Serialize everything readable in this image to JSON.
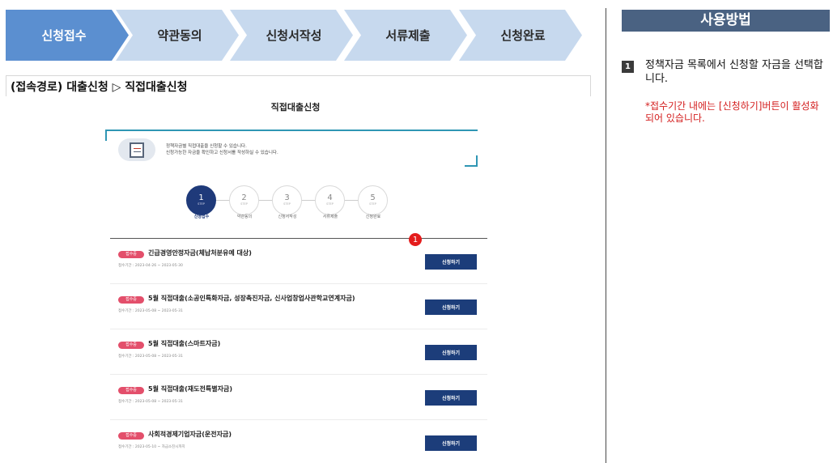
{
  "top_steps": [
    {
      "label": "신청접수",
      "active": true
    },
    {
      "label": "약관동의",
      "active": false
    },
    {
      "label": "신청서작성",
      "active": false
    },
    {
      "label": "서류제출",
      "active": false
    },
    {
      "label": "신청완료",
      "active": false
    }
  ],
  "access_path": "(접속경로) 대출신청 ▷ 직접대출신청",
  "inner": {
    "title": "직접대출신청",
    "info_line1": "정책자금별 직접대출을 신청할 수 있습니다.",
    "info_line2": "신청가능한 자금을 확인하고 신청서를 작성하실 수 있습니다.",
    "steps": [
      {
        "num": "1",
        "step": "STEP",
        "label": "신청접수"
      },
      {
        "num": "2",
        "step": "STEP",
        "label": "약관동의"
      },
      {
        "num": "3",
        "step": "STEP",
        "label": "신청서작성"
      },
      {
        "num": "4",
        "step": "STEP",
        "label": "서류제출"
      },
      {
        "num": "5",
        "step": "STEP",
        "label": "신청완료"
      }
    ],
    "marker": "1",
    "items": [
      {
        "badge": "접수중",
        "title": "긴급경영안정자금(체납처분유예 대상)",
        "period": "접수기간 : 2023-04-26 ~ 2023-05-30",
        "button": "신청하기"
      },
      {
        "badge": "접수중",
        "title": "5월 직접대출(소공인특화자금, 성장촉진자금, 신사업창업사관학교연계자금)",
        "period": "접수기간 : 2023-05-08 ~ 2023-05-31",
        "button": "신청하기"
      },
      {
        "badge": "접수중",
        "title": "5월 직접대출(스마트자금)",
        "period": "접수기간 : 2023-05-08 ~ 2023-05-31",
        "button": "신청하기"
      },
      {
        "badge": "접수중",
        "title": "5월 직접대출(재도전특별자금)",
        "period": "접수기간 : 2023-05-08 ~ 2023-05-31",
        "button": "신청하기"
      },
      {
        "badge": "접수중",
        "title": "사회적경제기업자금(운전자금)",
        "period": "접수기간 : 2023-05-10 ~ 자금소진시까지",
        "button": "신청하기"
      }
    ]
  },
  "panel": {
    "header": "사용방법",
    "step_num": "1",
    "instruction": "정책자금 목록에서 신청할 자금을 선택합니다.",
    "note": "*접수기간 내에는 [신청하기]버튼이 활성화 되어 있습니다."
  },
  "colors": {
    "active_step": "#5b8fd0",
    "inactive_step": "#c7d9ee",
    "panel_header": "#4a6282",
    "apply_button": "#1c3d7a",
    "badge": "#e34f6b",
    "note_text": "#d42020"
  }
}
